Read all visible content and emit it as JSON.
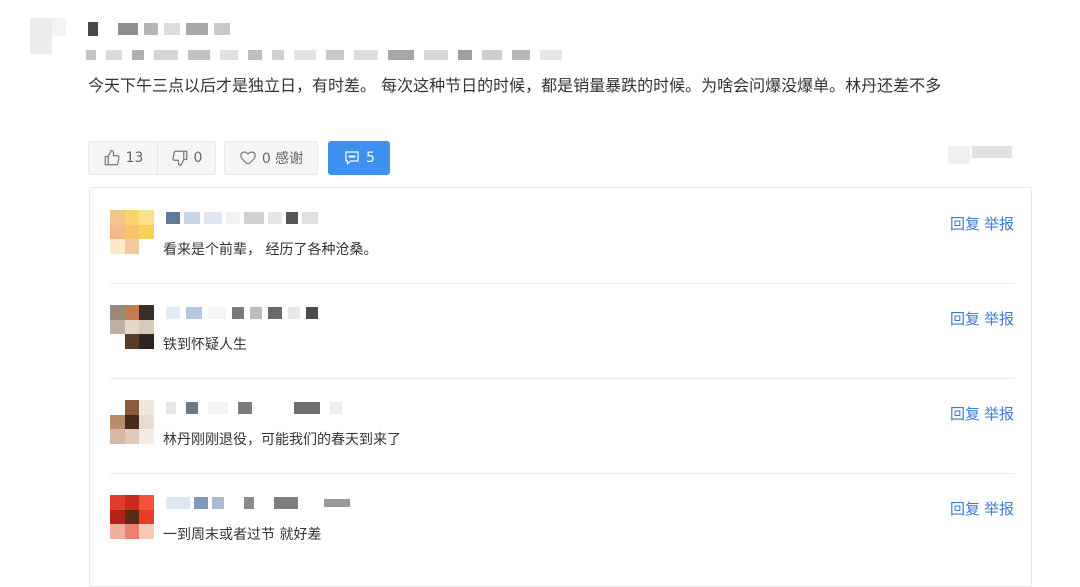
{
  "post": {
    "text": "今天下午三点以后才是独立日，有时差。 每次这种节日的时候，都是销量暴跌的时候。为啥会问爆没爆单。林丹还差不多"
  },
  "actions": {
    "like_count": "13",
    "dislike_count": "0",
    "thanks_label": "0 感谢",
    "comments_count": "5"
  },
  "replies": [
    {
      "text": "看来是个前辈， 经历了各种沧桑。",
      "reply_label": "回复",
      "report_label": "举报"
    },
    {
      "text": "铁到怀疑人生",
      "reply_label": "回复",
      "report_label": "举报"
    },
    {
      "text": "林丹刚刚退役，可能我们的春天到来了",
      "reply_label": "回复",
      "report_label": "举报"
    },
    {
      "text": "一到周末或者过节 就好差",
      "reply_label": "回复",
      "report_label": "举报"
    }
  ],
  "colors": {
    "accent": "#3e91ee",
    "link": "#3e7bd6",
    "text": "#333333",
    "muted": "#666666"
  },
  "icons": [
    "thumbs-up-icon",
    "thumbs-down-icon",
    "heart-icon",
    "comment-icon"
  ]
}
